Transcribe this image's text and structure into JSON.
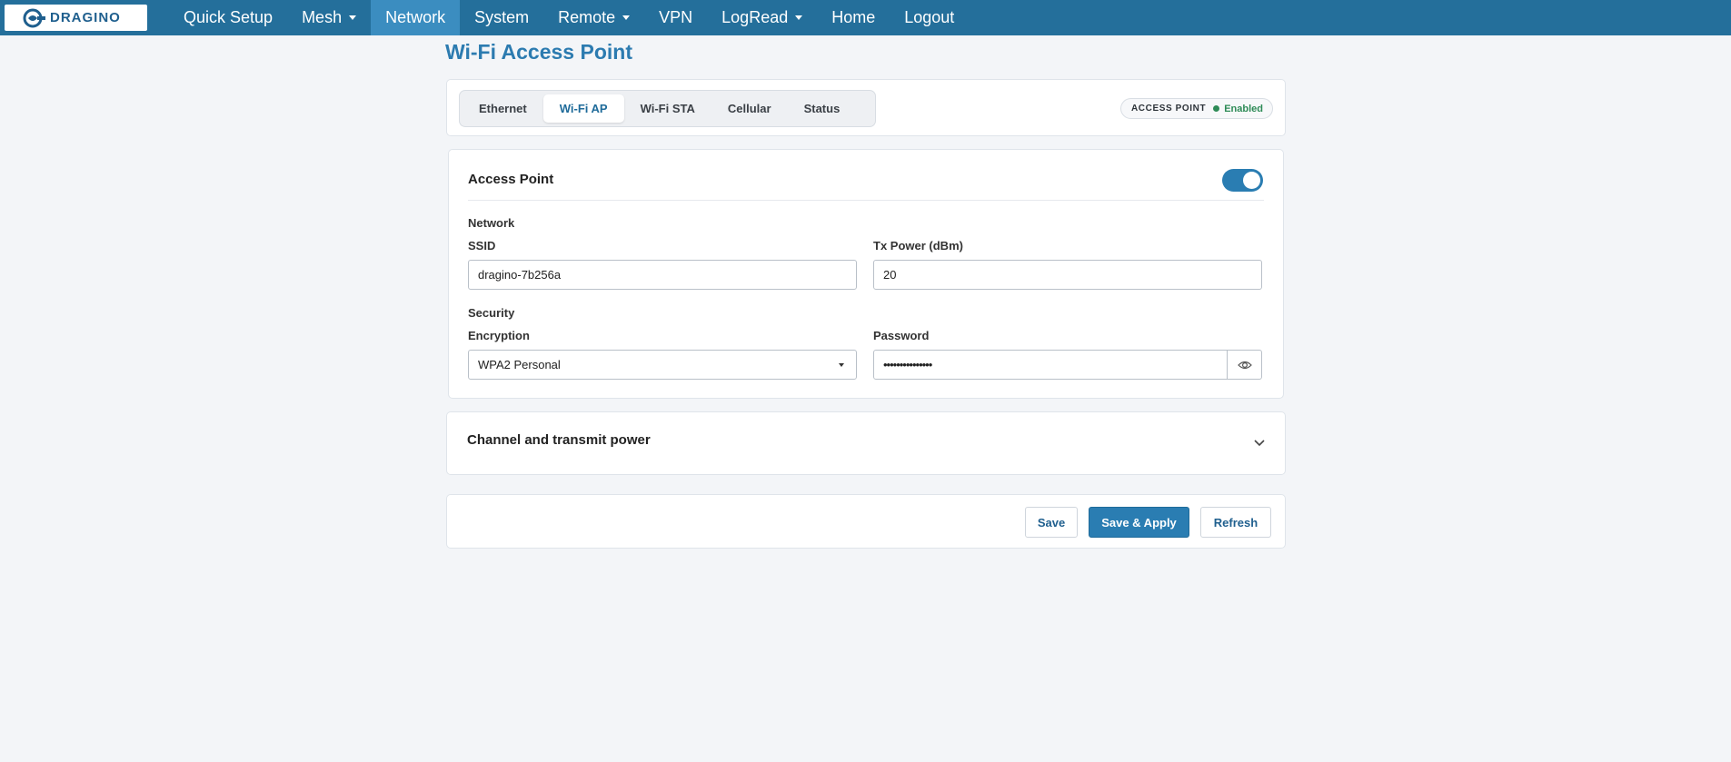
{
  "nav": {
    "logo_text": "DRAGINO",
    "items": [
      {
        "label": "Quick Setup",
        "has_caret": false,
        "active": false
      },
      {
        "label": "Mesh",
        "has_caret": true,
        "active": false
      },
      {
        "label": "Network",
        "has_caret": false,
        "active": true
      },
      {
        "label": "System",
        "has_caret": false,
        "active": false
      },
      {
        "label": "Remote",
        "has_caret": true,
        "active": false
      },
      {
        "label": "VPN",
        "has_caret": false,
        "active": false
      },
      {
        "label": "LogRead",
        "has_caret": true,
        "active": false
      },
      {
        "label": "Home",
        "has_caret": false,
        "active": false
      },
      {
        "label": "Logout",
        "has_caret": false,
        "active": false
      }
    ]
  },
  "page_title": "Wi-Fi Access Point",
  "tabs": [
    {
      "label": "Ethernet",
      "active": false
    },
    {
      "label": "Wi-Fi AP",
      "active": true
    },
    {
      "label": "Wi-Fi STA",
      "active": false
    },
    {
      "label": "Cellular",
      "active": false
    },
    {
      "label": "Status",
      "active": false
    }
  ],
  "status_badge": {
    "label": "ACCESS POINT",
    "state": "Enabled",
    "state_color": "#2e8b57"
  },
  "access_point": {
    "title": "Access Point",
    "enabled": true,
    "network_section": "Network",
    "ssid_label": "SSID",
    "ssid_value": "dragino-7b256a",
    "txpower_label": "Tx Power (dBm)",
    "txpower_value": "20",
    "security_section": "Security",
    "encryption_label": "Encryption",
    "encryption_value": "WPA2 Personal",
    "password_label": "Password",
    "password_masked": "•••••••••••••••"
  },
  "channel_section": {
    "title": "Channel and transmit power",
    "icon": "chevron-down-icon"
  },
  "actions": {
    "save": "Save",
    "save_apply": "Save & Apply",
    "refresh": "Refresh"
  },
  "colors": {
    "nav_bg": "#246f9b",
    "nav_active": "#3b8dc0",
    "accent": "#2a7db2",
    "title": "#2c7bb0"
  }
}
